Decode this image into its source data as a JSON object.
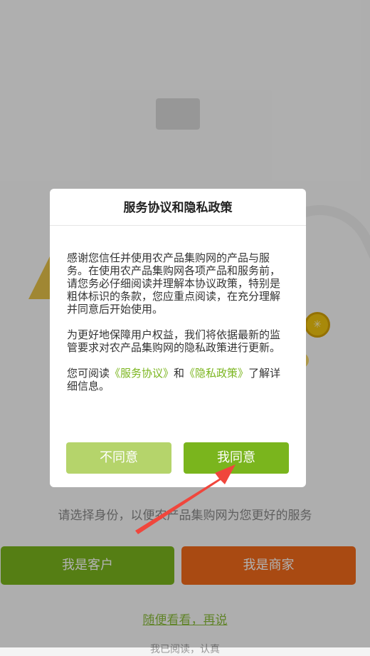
{
  "background": {
    "subtitle": "请选择身份，以便农产品集购网为您更好的服务",
    "customer_button": "我是客户",
    "merchant_button": "我是商家",
    "browse_link": "随便看看，再说",
    "bottom_text": "我已阅读，认真"
  },
  "dialog": {
    "title": "服务协议和隐私政策",
    "para1": "感谢您信任并使用农产品集购网的产品与服务。在使用农产品集购网各项产品和服务前，",
    "para1b": "请您务必仔细阅读并理解本协议政策，特别是粗体标识的条款，您应重点阅读，在充分理解并同意后开始使用。",
    "para2": "为更好地保障用户权益，我们将依据最新的监管要求对农产品集购网的隐私政策进行更新。",
    "para3_prefix": "您可阅读",
    "service_link": "《服务协议》",
    "para3_and": "和",
    "privacy_link": "《隐私政策》",
    "para3_suffix": "了解详细信息。",
    "disagree_label": "不同意",
    "agree_label": "我同意"
  },
  "colors": {
    "accent_green": "#7ab51d",
    "light_green": "#b5d46b",
    "merchant_orange": "#f26a1b",
    "arrow_red": "#f0463c"
  },
  "icons": {
    "coin": "coin-icon",
    "arrow": "pointer-arrow-icon"
  }
}
